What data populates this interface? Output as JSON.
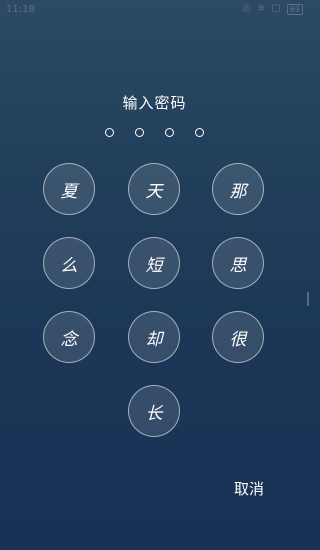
{
  "status_bar": {
    "time": "11:18",
    "icons": [
      "alarm-icon",
      "wifi-icon",
      "sim-icon"
    ],
    "battery": "69"
  },
  "lock": {
    "title": "输入密码",
    "pin_length": 4,
    "entered": 0,
    "keys": [
      "夏",
      "天",
      "那",
      "么",
      "短",
      "思",
      "念",
      "却",
      "很",
      "长"
    ],
    "cancel_label": "取消"
  }
}
